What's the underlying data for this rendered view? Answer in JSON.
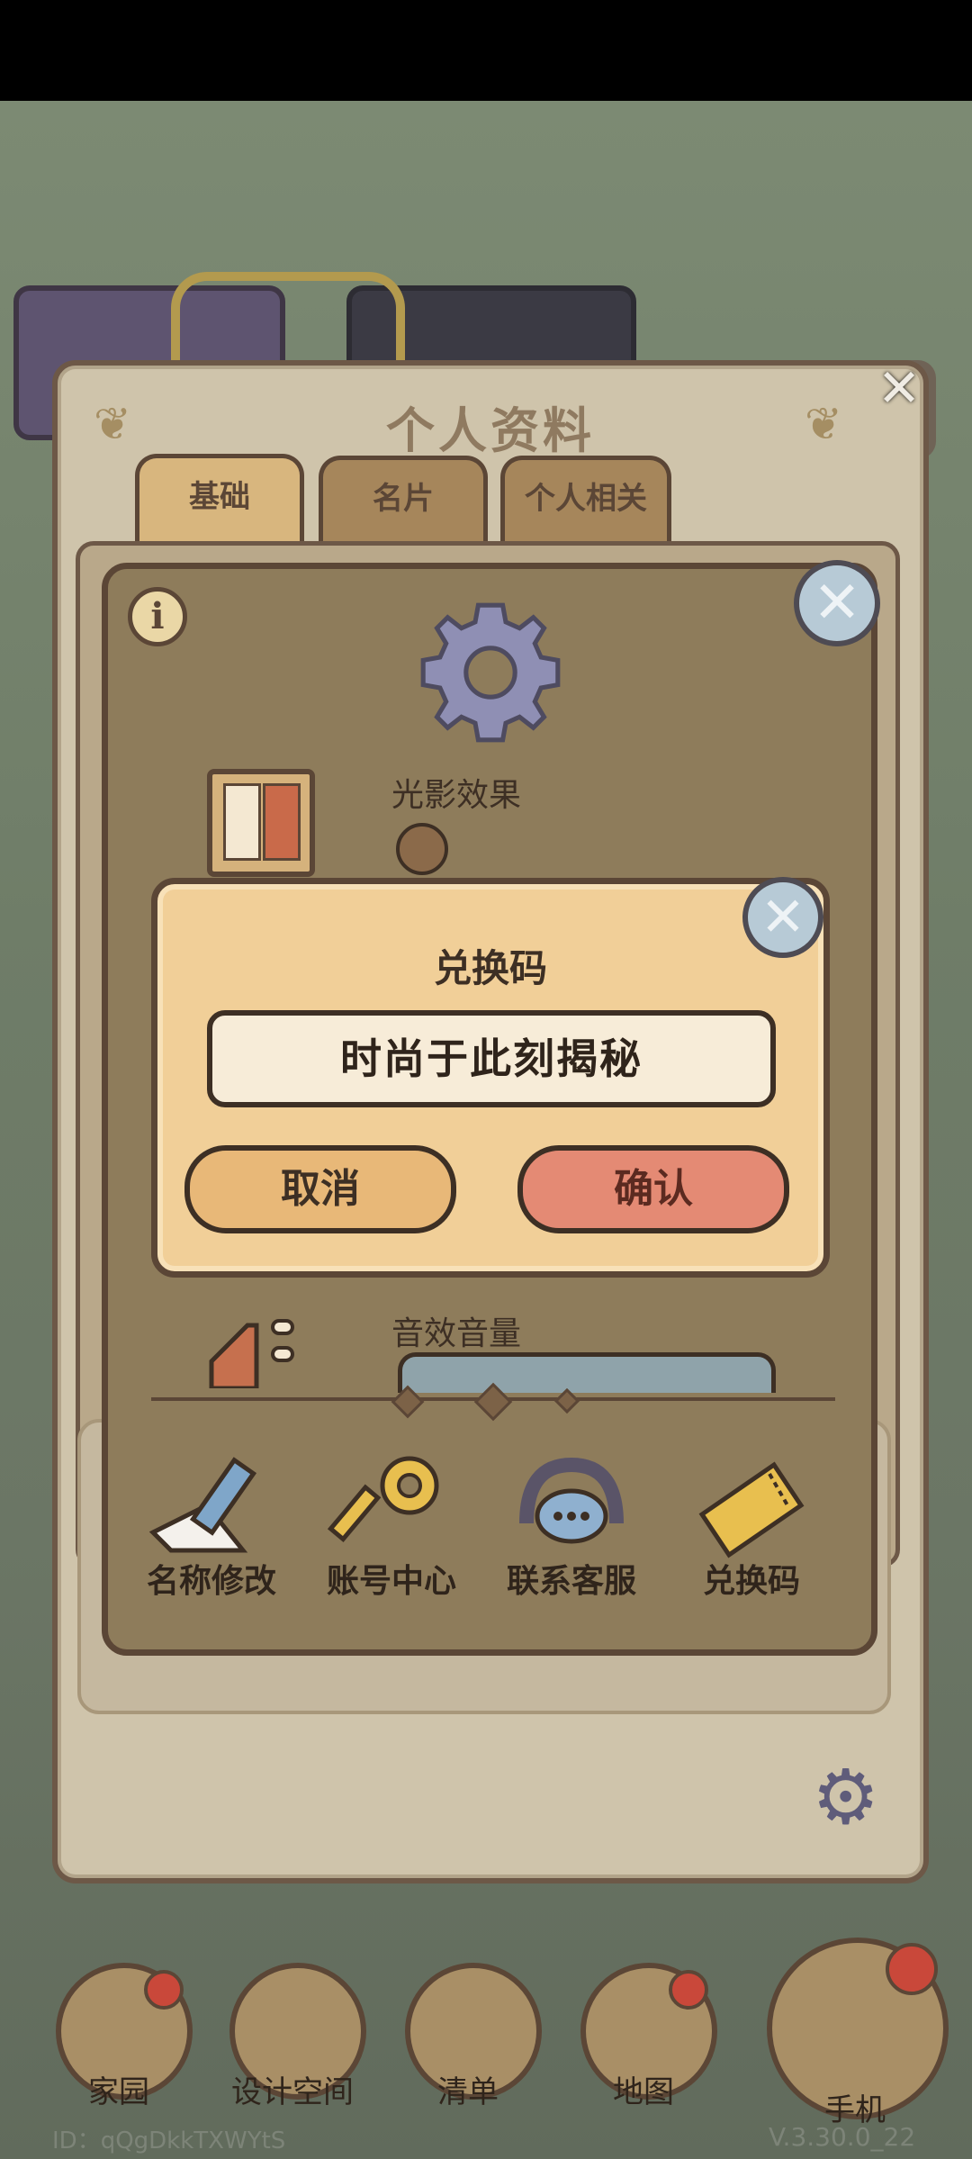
{
  "profile": {
    "title": "个人资料",
    "tabs": [
      {
        "label": "基础",
        "active": true
      },
      {
        "label": "名片",
        "active": false
      },
      {
        "label": "个人相关",
        "active": false
      }
    ]
  },
  "settings": {
    "info_icon": "i",
    "shadow_label": "光影效果",
    "sound_label": "音效音量",
    "functions": [
      {
        "label": "名称修改",
        "icon": "pencil-icon"
      },
      {
        "label": "账号中心",
        "icon": "key-icon"
      },
      {
        "label": "联系客服",
        "icon": "headset-icon"
      },
      {
        "label": "兑换码",
        "icon": "ticket-icon"
      }
    ]
  },
  "redeem": {
    "title": "兑换码",
    "code_value": "时尚于此刻揭秘",
    "cancel_label": "取消",
    "confirm_label": "确认"
  },
  "nav": {
    "items": [
      {
        "label": "家园",
        "badge": true
      },
      {
        "label": "设计空间",
        "badge": false
      },
      {
        "label": "清单",
        "badge": false
      },
      {
        "label": "地图",
        "badge": true
      },
      {
        "label": "手机",
        "badge": true
      }
    ]
  },
  "footer": {
    "id_text": "ID：qQgDkkTXWYtS",
    "version": "V.3.30.0_22"
  },
  "colors": {
    "panel_bg": "#cfc4ab",
    "dialog_bg": "#8e7c5b",
    "popup_bg": "#f1cf98",
    "confirm_button": "#e48a74",
    "cancel_button": "#e8b878",
    "outline": "#5b4636"
  }
}
